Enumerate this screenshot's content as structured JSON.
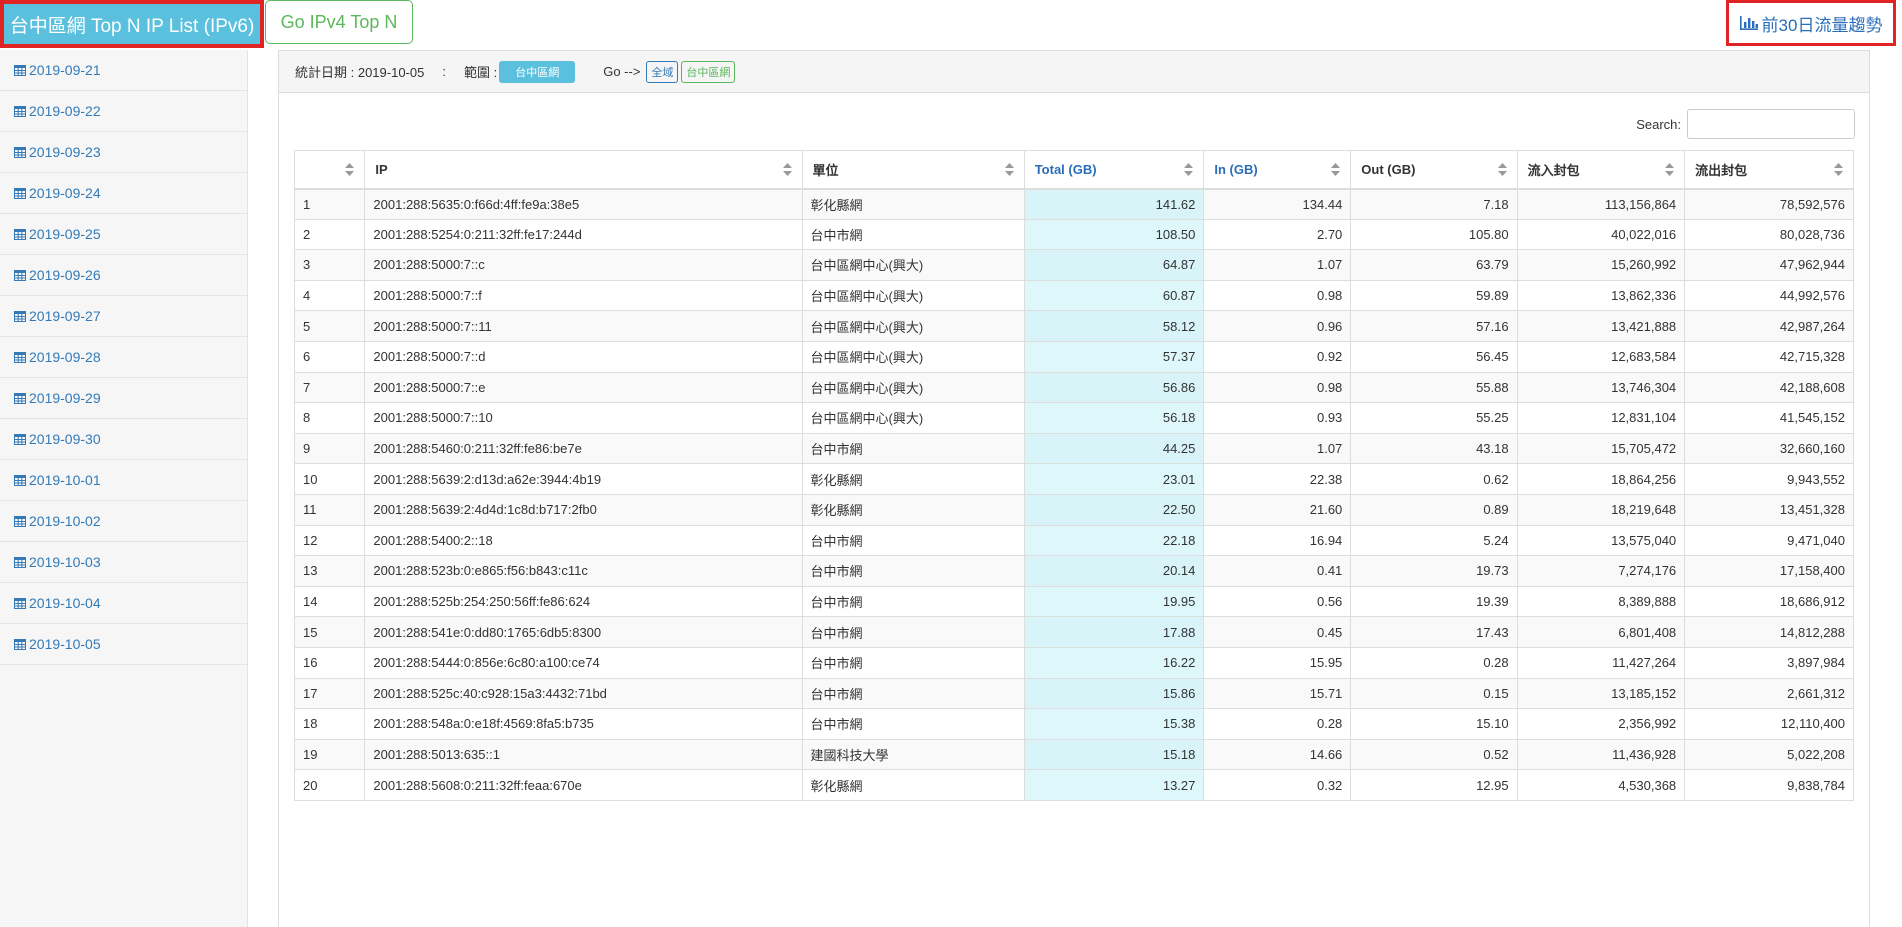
{
  "header": {
    "title_button": "台中區網 Top N IP List (IPv6)",
    "ipv4_button": "Go IPv4 Top N",
    "trend_link": "前30日流量趨勢",
    "trend_icon": "bar-chart-icon"
  },
  "sidebar": {
    "icon": "table-icon",
    "items": [
      "2019-09-21",
      "2019-09-22",
      "2019-09-23",
      "2019-09-24",
      "2019-09-25",
      "2019-09-26",
      "2019-09-27",
      "2019-09-28",
      "2019-09-29",
      "2019-09-30",
      "2019-10-01",
      "2019-10-02",
      "2019-10-03",
      "2019-10-04",
      "2019-10-05"
    ]
  },
  "panel": {
    "date_label": "統計日期 : 2019-10-05",
    "separator": ":",
    "scope_label": "範圍 :",
    "scope_value": "台中區網",
    "go_label": "Go -->",
    "go_links": [
      "全域",
      "台中區網"
    ],
    "search_label": "Search:",
    "search_value": ""
  },
  "colors": {
    "primary": "#5bc0de",
    "success": "#5cb85c",
    "link": "#337ab7",
    "highlight_column": "#ddf7fb",
    "emphasis_border": "#e02424"
  },
  "table": {
    "columns": [
      "",
      "IP",
      "單位",
      "Total (GB)",
      "In (GB)",
      "Out (GB)",
      "流入封包",
      "流出封包"
    ],
    "rows": [
      [
        "1",
        "2001:288:5635:0:f66d:4ff:fe9a:38e5",
        "彰化縣網",
        "141.62",
        "134.44",
        "7.18",
        "113,156,864",
        "78,592,576"
      ],
      [
        "2",
        "2001:288:5254:0:211:32ff:fe17:244d",
        "台中市網",
        "108.50",
        "2.70",
        "105.80",
        "40,022,016",
        "80,028,736"
      ],
      [
        "3",
        "2001:288:5000:7::c",
        "台中區網中心(興大)",
        "64.87",
        "1.07",
        "63.79",
        "15,260,992",
        "47,962,944"
      ],
      [
        "4",
        "2001:288:5000:7::f",
        "台中區網中心(興大)",
        "60.87",
        "0.98",
        "59.89",
        "13,862,336",
        "44,992,576"
      ],
      [
        "5",
        "2001:288:5000:7::11",
        "台中區網中心(興大)",
        "58.12",
        "0.96",
        "57.16",
        "13,421,888",
        "42,987,264"
      ],
      [
        "6",
        "2001:288:5000:7::d",
        "台中區網中心(興大)",
        "57.37",
        "0.92",
        "56.45",
        "12,683,584",
        "42,715,328"
      ],
      [
        "7",
        "2001:288:5000:7::e",
        "台中區網中心(興大)",
        "56.86",
        "0.98",
        "55.88",
        "13,746,304",
        "42,188,608"
      ],
      [
        "8",
        "2001:288:5000:7::10",
        "台中區網中心(興大)",
        "56.18",
        "0.93",
        "55.25",
        "12,831,104",
        "41,545,152"
      ],
      [
        "9",
        "2001:288:5460:0:211:32ff:fe86:be7e",
        "台中市網",
        "44.25",
        "1.07",
        "43.18",
        "15,705,472",
        "32,660,160"
      ],
      [
        "10",
        "2001:288:5639:2:d13d:a62e:3944:4b19",
        "彰化縣網",
        "23.01",
        "22.38",
        "0.62",
        "18,864,256",
        "9,943,552"
      ],
      [
        "11",
        "2001:288:5639:2:4d4d:1c8d:b717:2fb0",
        "彰化縣網",
        "22.50",
        "21.60",
        "0.89",
        "18,219,648",
        "13,451,328"
      ],
      [
        "12",
        "2001:288:5400:2::18",
        "台中市網",
        "22.18",
        "16.94",
        "5.24",
        "13,575,040",
        "9,471,040"
      ],
      [
        "13",
        "2001:288:523b:0:e865:f56:b843:c11c",
        "台中市網",
        "20.14",
        "0.41",
        "19.73",
        "7,274,176",
        "17,158,400"
      ],
      [
        "14",
        "2001:288:525b:254:250:56ff:fe86:624",
        "台中市網",
        "19.95",
        "0.56",
        "19.39",
        "8,389,888",
        "18,686,912"
      ],
      [
        "15",
        "2001:288:541e:0:dd80:1765:6db5:8300",
        "台中市網",
        "17.88",
        "0.45",
        "17.43",
        "6,801,408",
        "14,812,288"
      ],
      [
        "16",
        "2001:288:5444:0:856e:6c80:a100:ce74",
        "台中市網",
        "16.22",
        "15.95",
        "0.28",
        "11,427,264",
        "3,897,984"
      ],
      [
        "17",
        "2001:288:525c:40:c928:15a3:4432:71bd",
        "台中市網",
        "15.86",
        "15.71",
        "0.15",
        "13,185,152",
        "2,661,312"
      ],
      [
        "18",
        "2001:288:548a:0:e18f:4569:8fa5:b735",
        "台中市網",
        "15.38",
        "0.28",
        "15.10",
        "2,356,992",
        "12,110,400"
      ],
      [
        "19",
        "2001:288:5013:635::1",
        "建國科技大學",
        "15.18",
        "14.66",
        "0.52",
        "11,436,928",
        "5,022,208"
      ],
      [
        "20",
        "2001:288:5608:0:211:32ff:feaa:670e",
        "彰化縣網",
        "13.27",
        "0.32",
        "12.95",
        "4,530,368",
        "9,838,784"
      ]
    ]
  }
}
